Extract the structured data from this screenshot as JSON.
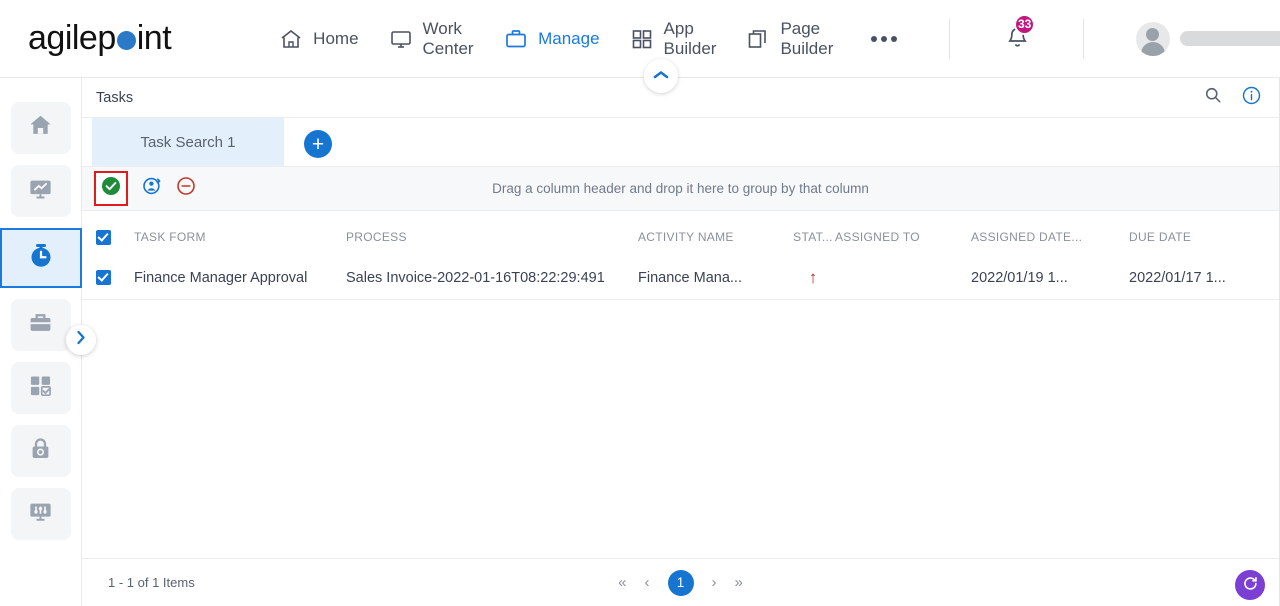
{
  "brand": {
    "name_part1": "agilep",
    "name_part2": "int",
    "dot_color": "#2a7ac7"
  },
  "topnav": {
    "items": [
      {
        "label": "Home",
        "icon": "home-icon",
        "active": false
      },
      {
        "label": "Work Center",
        "icon": "monitor-icon",
        "active": false
      },
      {
        "label": "Manage",
        "icon": "briefcase-icon",
        "active": true
      },
      {
        "label": "App Builder",
        "icon": "grid-icon",
        "active": false
      },
      {
        "label": "Page Builder",
        "icon": "copy-pages-icon",
        "active": false
      }
    ],
    "more_label": "...",
    "notification_count": "33",
    "username": "",
    "accent_active": "#1b7ae0"
  },
  "rail": {
    "items": [
      {
        "name": "home",
        "icon": "home-icon",
        "active": false
      },
      {
        "name": "reports",
        "icon": "chart-monitor-icon",
        "active": false
      },
      {
        "name": "tasks",
        "icon": "clock-icon",
        "active": true
      },
      {
        "name": "work",
        "icon": "briefcase-icon",
        "active": false
      },
      {
        "name": "apps",
        "icon": "grid-check-icon",
        "active": false
      },
      {
        "name": "access",
        "icon": "lock-icon",
        "active": false
      },
      {
        "name": "settings",
        "icon": "sliders-icon",
        "active": false
      }
    ]
  },
  "page": {
    "title": "Tasks",
    "search_icon": "search-icon",
    "info_icon": "info-circle-icon"
  },
  "tabs": {
    "items": [
      {
        "label": "Task Search 1",
        "active": true
      }
    ],
    "add_label": "+"
  },
  "toolbar": {
    "actions": [
      {
        "name": "complete-task",
        "icon": "check-circle-icon",
        "color": "#1e8c3a",
        "highlighted": true
      },
      {
        "name": "reassign-task",
        "icon": "reassign-user-icon",
        "color": "#1675d1",
        "highlighted": false
      },
      {
        "name": "cancel-task",
        "icon": "minus-circle-icon",
        "color": "#c0392b",
        "highlighted": false
      }
    ],
    "group_hint": "Drag a column header and drop it here to group by that column",
    "highlight_color": "#e01b1b"
  },
  "table": {
    "columns": [
      "TASK FORM",
      "PROCESS",
      "ACTIVITY NAME",
      "STAT...",
      "ASSIGNED TO",
      "ASSIGNED DATE...",
      "DUE DATE"
    ],
    "header_checked": true,
    "rows": [
      {
        "checked": true,
        "task_form": "Finance Manager Approval",
        "process": "Sales Invoice-2022-01-16T08:22:29:491",
        "activity_name": "Finance Mana...",
        "status": "↑",
        "assigned_to": "",
        "assigned_date": "2022/01/19 1...",
        "due_date": "2022/01/17 1..."
      }
    ]
  },
  "footer": {
    "items_count": "1 - 1 of 1 Items",
    "pager": {
      "first": "«",
      "prev": "‹",
      "current": "1",
      "next": "›",
      "last": "»"
    },
    "refresh_icon": "refresh-icon",
    "refresh_color": "#7b3fd4"
  }
}
